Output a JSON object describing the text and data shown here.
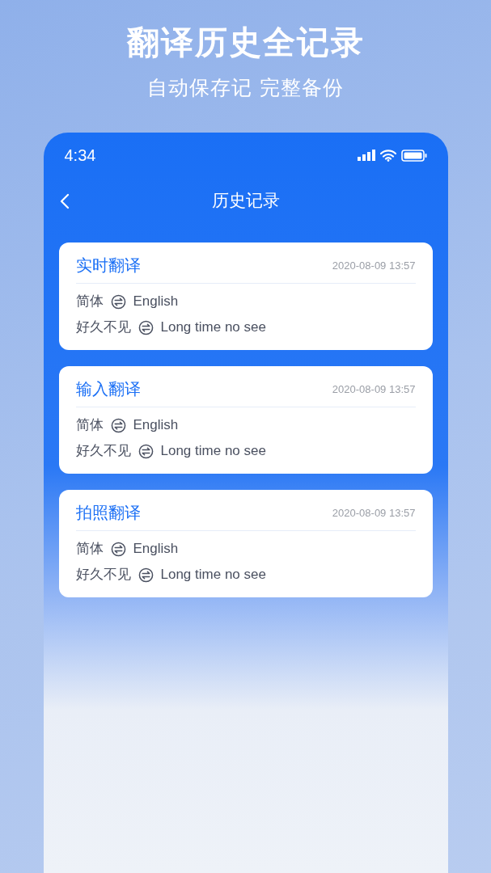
{
  "headline": "翻译历史全记录",
  "subtitle": "自动保存记 完整备份",
  "phone": {
    "status_bar": {
      "time": "4:34"
    },
    "nav": {
      "title": "历史记录"
    },
    "records": [
      {
        "title": "实时翻译",
        "date": "2020-08-09 13:57",
        "source_lang": "简体",
        "target_lang": "English",
        "source_text": "好久不见",
        "target_text": "Long time no see"
      },
      {
        "title": "输入翻译",
        "date": "2020-08-09 13:57",
        "source_lang": "简体",
        "target_lang": "English",
        "source_text": "好久不见",
        "target_text": "Long time no see"
      },
      {
        "title": "拍照翻译",
        "date": "2020-08-09 13:57",
        "source_lang": "简体",
        "target_lang": "English",
        "source_text": "好久不见",
        "target_text": "Long time no see"
      }
    ]
  }
}
